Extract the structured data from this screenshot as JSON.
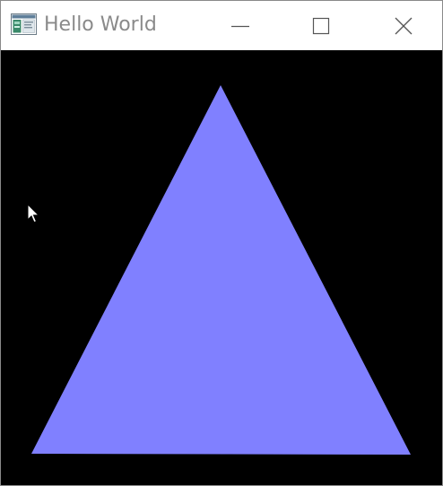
{
  "window": {
    "title": "Hello World",
    "icon": "application-icon"
  },
  "controls": {
    "minimize_icon": "minimize-icon",
    "maximize_icon": "maximize-icon",
    "close_icon": "close-icon"
  },
  "canvas": {
    "background": "#000000",
    "triangle_color": "#8080ff",
    "cursor_icon": "mouse-pointer-icon"
  }
}
